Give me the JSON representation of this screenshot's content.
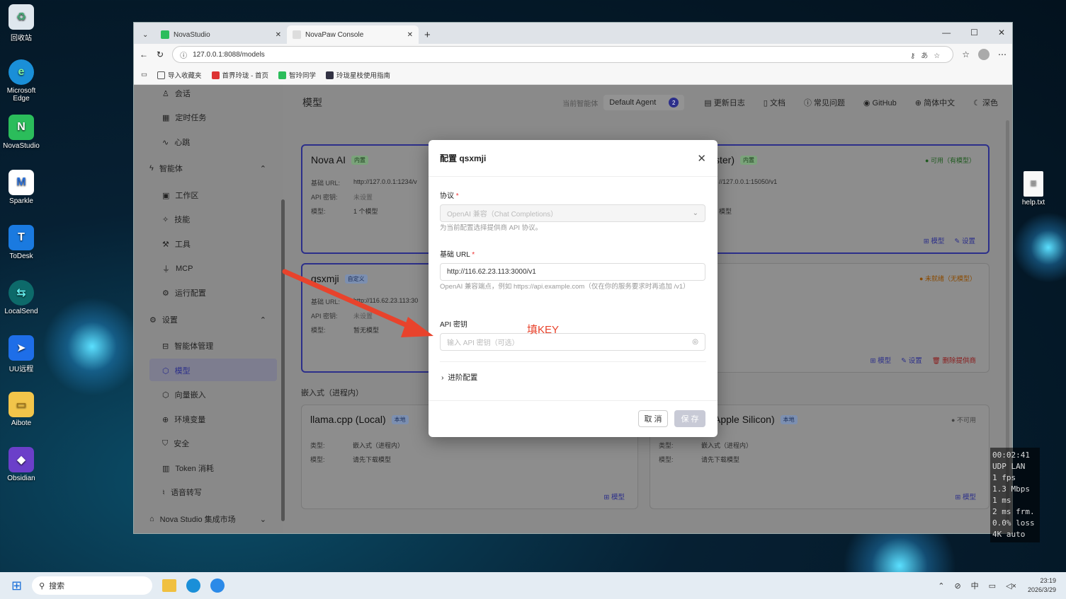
{
  "desktop": {
    "icons": [
      "回收站",
      "Microsoft Edge",
      "NovaStudio",
      "Sparkle",
      "ToDesk",
      "LocalSend",
      "UU远程",
      "Aibote",
      "Obsidian"
    ],
    "right_icon": "help.txt"
  },
  "browser": {
    "tabs": [
      "NovaStudio",
      "NovaPaw Console"
    ],
    "url": "127.0.0.1:8088/models",
    "bookmarks": [
      "导入收藏夹",
      "首界玲珑 - 首页",
      "智玲同学",
      "玲珑星枝使用指南"
    ]
  },
  "sidebar": {
    "items": [
      "会话",
      "定时任务",
      "心跳"
    ],
    "section_agent": "智能体",
    "agent_items": [
      "工作区",
      "技能",
      "工具",
      "MCP",
      "运行配置"
    ],
    "section_settings": "设置",
    "settings_items": [
      "智能体管理",
      "模型",
      "向量嵌入",
      "环境变量",
      "安全",
      "Token 消耗",
      "语音转写"
    ],
    "market": "Nova Studio 集成市场"
  },
  "topbar": {
    "title": "模型",
    "current_agent_label": "当前智能体",
    "agent": "Default Agent",
    "agent_count": "2",
    "links": [
      "更新日志",
      "文档",
      "常见问题",
      "GitHub",
      "简体中文",
      "深色"
    ]
  },
  "cards": {
    "nova": {
      "title": "Nova AI",
      "tag": "内置",
      "url_label": "基础 URL:",
      "url": "http://127.0.0.1:1234/v",
      "key_label": "API 密钥:",
      "key": "未设置",
      "model_label": "模型:",
      "models": "1 个模型"
    },
    "right1": {
      "title": "ster)",
      "tag": "内置",
      "status": "可用（有模型）",
      "url": "//127.0.0.1:15050/v1",
      "models": "模型"
    },
    "qsxmji": {
      "title": "qsxmji",
      "tag": "自定义",
      "url_label": "基础 URL:",
      "url": "http://116.62.23.113:30",
      "key_label": "API 密钥:",
      "key": "未设置",
      "model_label": "模型:",
      "models": "暂无模型"
    },
    "right2": {
      "status": "未就绪（无模型）",
      "delete": "删除提供商"
    },
    "section_embedded": "嵌入式（进程内）",
    "llama": {
      "title": "llama.cpp (Local)",
      "tag": "本地",
      "type_label": "类型:",
      "type": "嵌入式（进程内）",
      "model_label": "模型:",
      "models": "请先下载模型"
    },
    "apple": {
      "title": "Apple Silicon)",
      "tag": "本地",
      "status": "不可用",
      "type": "嵌入式（进程内）",
      "models": "请先下载模型"
    },
    "btn_models": "模型",
    "btn_settings": "设置"
  },
  "modal": {
    "title": "配置 qsxmji",
    "protocol_label": "协议",
    "protocol_value": "OpenAI 兼容（Chat Completions）",
    "protocol_hint": "为当前配置选择提供商 API 协议。",
    "url_label": "基础 URL",
    "url_value": "http://116.62.23.113:3000/v1",
    "url_hint": "OpenAI 兼容端点，例如 https://api.example.com（仅在你的服务要求时再追加 /v1）",
    "key_label": "API 密钥",
    "key_placeholder": "输入 API 密钥（可选）",
    "advanced": "进阶配置",
    "cancel": "取 消",
    "save": "保 存"
  },
  "annotation": "填KEY",
  "stats": [
    "00:02:41",
    "UDP LAN",
    "1 fps",
    "1.3 Mbps",
    "1 ms",
    "2 ms frm.",
    "0.0% loss",
    "4K auto"
  ],
  "taskbar": {
    "search": "搜索",
    "time": "23:19",
    "date": "2026/3/29",
    "ime": "中"
  }
}
